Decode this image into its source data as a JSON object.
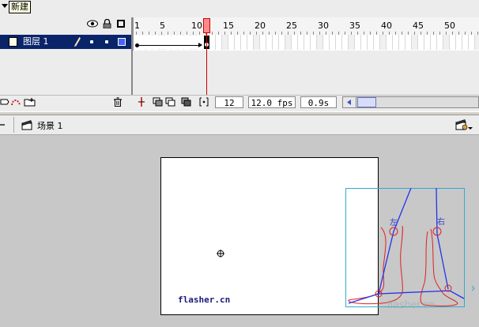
{
  "timeline": {
    "caption": "新建",
    "layer": {
      "name": "图层 1"
    },
    "frame_numbers": [
      "1",
      "5",
      "10",
      "15",
      "20",
      "25",
      "30",
      "35",
      "40",
      "45",
      "50"
    ],
    "current_frame": "12",
    "frame_rate": "12.0 fps",
    "elapsed_time": "0.9s"
  },
  "edit_bar": {
    "scene_label": "场景 1"
  },
  "stage": {
    "text": "flasher.cn",
    "symbol_label_left": "左",
    "symbol_label_right": "右",
    "watermark": "flasher.cn"
  },
  "colors": {
    "selected_layer": "#0a246a",
    "playhead": "#cc0000",
    "layer_outline": "#4466ff",
    "symbol_bbox": "#33aacc",
    "foot_stroke": "#dd2222",
    "bone_stroke": "#2233ee"
  }
}
